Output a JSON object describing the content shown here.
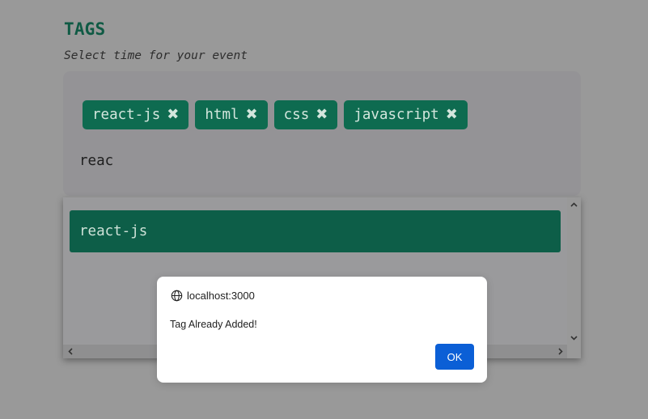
{
  "page": {
    "title": "TAGS",
    "subtitle": "Select time for your event"
  },
  "tags": [
    {
      "label": "react-js",
      "remove_icon": "close-icon"
    },
    {
      "label": "html",
      "remove_icon": "close-icon"
    },
    {
      "label": "css",
      "remove_icon": "close-icon"
    },
    {
      "label": "javascript",
      "remove_icon": "close-icon"
    }
  ],
  "input": {
    "value": "reac"
  },
  "suggestions": [
    {
      "label": "react-js"
    }
  ],
  "dialog": {
    "origin": "localhost:3000",
    "origin_icon": "globe-icon",
    "message": "Tag Already Added!",
    "ok_label": "OK"
  },
  "colors": {
    "accent": "#0e6b50",
    "dialog_button": "#0b5fd6",
    "backdrop": "#999999"
  }
}
